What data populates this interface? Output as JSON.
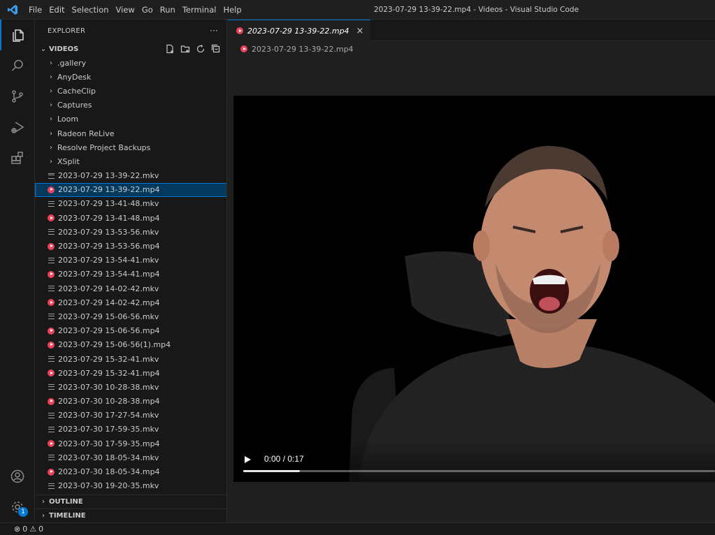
{
  "titlebar": {
    "menus": [
      "File",
      "Edit",
      "Selection",
      "View",
      "Go",
      "Run",
      "Terminal",
      "Help"
    ],
    "window_title": "2023-07-29 13-39-22.mp4 - Videos - Visual Studio Code"
  },
  "activitybar": {
    "items": [
      "files-icon",
      "search-icon",
      "source-control-icon",
      "run-debug-icon",
      "extensions-icon"
    ],
    "accounts": "account-icon",
    "settings_badge": "1"
  },
  "sidebar": {
    "title": "EXPLORER",
    "more": "···",
    "section": "VIDEOS",
    "folders": [
      ".gallery",
      "AnyDesk",
      "CacheClip",
      "Captures",
      "Loom",
      "Radeon ReLive",
      "Resolve Project Backups",
      "XSplit"
    ],
    "files": [
      {
        "name": "2023-07-29 13-39-22.mkv",
        "type": "mkv"
      },
      {
        "name": "2023-07-29 13-39-22.mp4",
        "type": "mp4",
        "selected": true
      },
      {
        "name": "2023-07-29 13-41-48.mkv",
        "type": "mkv"
      },
      {
        "name": "2023-07-29 13-41-48.mp4",
        "type": "mp4"
      },
      {
        "name": "2023-07-29 13-53-56.mkv",
        "type": "mkv"
      },
      {
        "name": "2023-07-29 13-53-56.mp4",
        "type": "mp4"
      },
      {
        "name": "2023-07-29 13-54-41.mkv",
        "type": "mkv"
      },
      {
        "name": "2023-07-29 13-54-41.mp4",
        "type": "mp4"
      },
      {
        "name": "2023-07-29 14-02-42.mkv",
        "type": "mkv"
      },
      {
        "name": "2023-07-29 14-02-42.mp4",
        "type": "mp4"
      },
      {
        "name": "2023-07-29 15-06-56.mkv",
        "type": "mkv"
      },
      {
        "name": "2023-07-29 15-06-56.mp4",
        "type": "mp4"
      },
      {
        "name": "2023-07-29 15-06-56(1).mp4",
        "type": "mp4"
      },
      {
        "name": "2023-07-29 15-32-41.mkv",
        "type": "mkv"
      },
      {
        "name": "2023-07-29 15-32-41.mp4",
        "type": "mp4"
      },
      {
        "name": "2023-07-30 10-28-38.mkv",
        "type": "mkv"
      },
      {
        "name": "2023-07-30 10-28-38.mp4",
        "type": "mp4"
      },
      {
        "name": "2023-07-30 17-27-54.mkv",
        "type": "mkv"
      },
      {
        "name": "2023-07-30 17-59-35.mkv",
        "type": "mkv"
      },
      {
        "name": "2023-07-30 17-59-35.mp4",
        "type": "mp4"
      },
      {
        "name": "2023-07-30 18-05-34.mkv",
        "type": "mkv"
      },
      {
        "name": "2023-07-30 18-05-34.mp4",
        "type": "mp4"
      },
      {
        "name": "2023-07-30 19-20-35.mkv",
        "type": "mkv"
      }
    ],
    "outline": "OUTLINE",
    "timeline": "TIMELINE"
  },
  "editor": {
    "tab_label": "2023-07-29 13-39-22.mp4",
    "tab_close": "×",
    "breadcrumb": "2023-07-29 13-39-22.mp4",
    "video": {
      "timecode": "0:00 / 0:17",
      "progress": 0.12
    }
  },
  "statusbar": {
    "errors": "0",
    "warnings": "0"
  },
  "colors": {
    "accent": "#0078d4",
    "mp4_icon": "#e8435a",
    "selected_row": "#04395e"
  }
}
